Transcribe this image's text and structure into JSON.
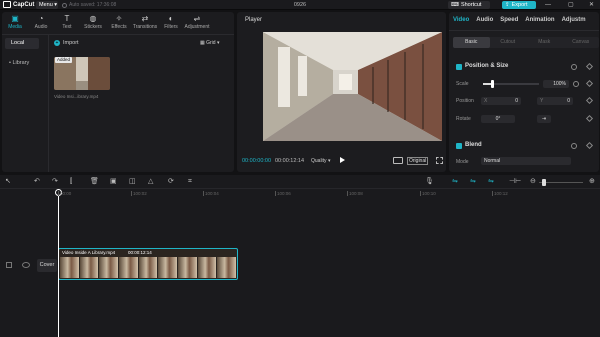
{
  "app": {
    "name": "CapCut",
    "menu": "Menu",
    "autosave": "Auto saved: 17:36:08",
    "project_title": "0926",
    "shortcut": "Shortcut",
    "export": "Export"
  },
  "window": {
    "minimize": "—",
    "maximize": "▢",
    "close": "✕"
  },
  "media_tools": [
    {
      "label": "Media",
      "icon": "media-icon"
    },
    {
      "label": "Audio",
      "icon": "audio-icon"
    },
    {
      "label": "Text",
      "icon": "text-icon"
    },
    {
      "label": "Stickers",
      "icon": "stickers-icon"
    },
    {
      "label": "Effects",
      "icon": "effects-icon"
    },
    {
      "label": "Transitions",
      "icon": "transitions-icon"
    },
    {
      "label": "Filters",
      "icon": "filters-icon"
    },
    {
      "label": "Adjustment",
      "icon": "adjustment-icon"
    }
  ],
  "media": {
    "local": "Local",
    "library": "• Library",
    "import": "Import",
    "grid": "Grid",
    "added": "Added",
    "clip_name": "Video Insi...ibrary.mp4"
  },
  "player": {
    "title": "Player",
    "timecode_current": "00:00:00:00",
    "timecode_total": "00:00:12:14",
    "quality": "Quality",
    "original": "Original"
  },
  "inspector": {
    "tabs": [
      "Video",
      "Audio",
      "Speed",
      "Animation",
      "Adjustm"
    ],
    "subtabs": [
      "Basic",
      "Cutout",
      "Mask",
      "Canvas"
    ],
    "position_size": "Position & Size",
    "scale_label": "Scale",
    "scale_value": "100%",
    "position_label": "Position",
    "pos_x_label": "X",
    "pos_x": "0",
    "pos_y_label": "Y",
    "pos_y": "0",
    "rotate_label": "Rotate",
    "rotate_value": "0°",
    "blend": "Blend",
    "mode_label": "Mode",
    "mode_value": "Normal",
    "scale_fraction": 0.2
  },
  "timeline": {
    "ruler": [
      "00:00",
      "100:02",
      "100:04",
      "100:06",
      "100:08",
      "100:10",
      "100:12"
    ],
    "cover": "Cover",
    "clip_label": "Video Inside A Library.mp4",
    "clip_tc": "00:00:12:14"
  },
  "colors": {
    "accent": "#1fb5c7"
  }
}
